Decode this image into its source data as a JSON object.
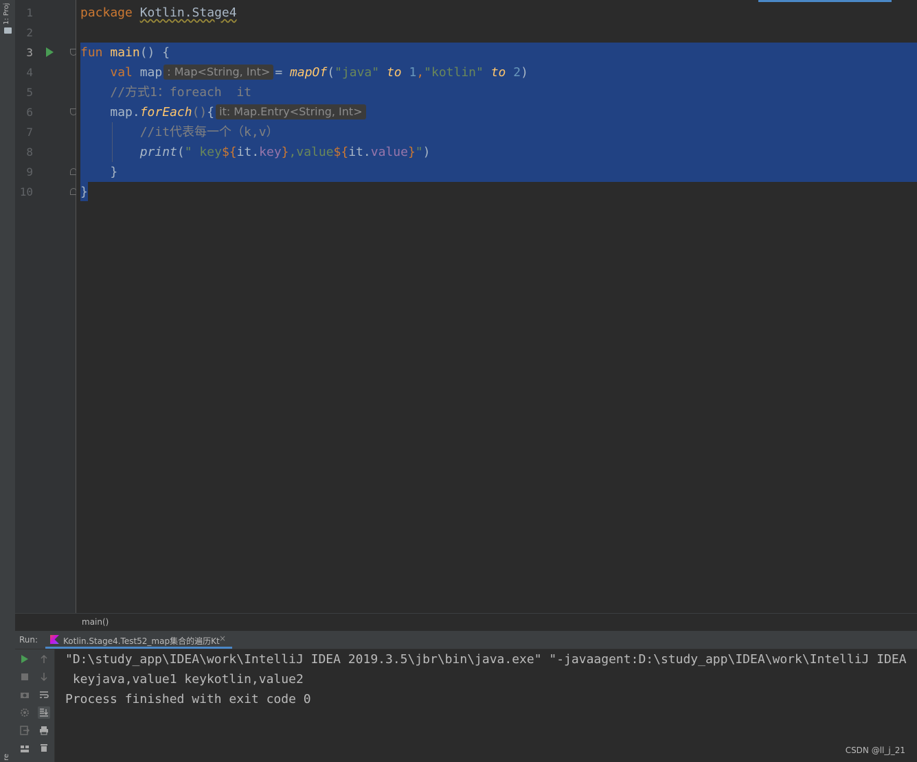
{
  "left_strip": {
    "project_label": "1: Proj",
    "bottom_label": "re"
  },
  "gutter": {
    "line_numbers": [
      "1",
      "2",
      "3",
      "4",
      "5",
      "6",
      "7",
      "8",
      "9",
      "10"
    ]
  },
  "code": {
    "l1_package_kw": "package",
    "l1_package_name": "Kotlin.Stage4",
    "l3_fun_kw": "fun",
    "l3_fun_name": "main",
    "l3_rest": "() {",
    "l4_val_kw": "val",
    "l4_var": "map",
    "l4_type_hint": ": Map<String, Int>",
    "l4_eq": "=",
    "l4_call": "mapOf",
    "l4_paren_open": "(",
    "l4_str1": "\"java\"",
    "l4_to1": "to",
    "l4_num1": "1",
    "l4_comma": ",",
    "l4_str2": "\"kotlin\"",
    "l4_to2": "to",
    "l4_num2": "2",
    "l4_paren_close": ")",
    "l5_comment": "//方式1：foreach  it",
    "l6_recv": "map.",
    "l6_call": "forEach",
    "l6_parens": "()",
    "l6_brace": "{",
    "l6_hint": "it: Map.Entry<String, Int>",
    "l7_comment": "//it代表每一个（k,v）",
    "l8_print": "print",
    "l8_open": "(",
    "l8_q1": "\"",
    "l8_str_a": " key",
    "l8_tmpl1_open": "${",
    "l8_it1": "it",
    "l8_dot1": ".",
    "l8_prop1": "key",
    "l8_tmpl1_close": "}",
    "l8_str_b": ",value",
    "l8_tmpl2_open": "${",
    "l8_it2": "it",
    "l8_dot2": ".",
    "l8_prop2": "value",
    "l8_tmpl2_close": "}",
    "l8_q2": "\"",
    "l8_close": ")",
    "l9_brace": "}",
    "l10_brace": "}"
  },
  "breadcrumb": {
    "label": "main()"
  },
  "run_panel": {
    "run_label": "Run:",
    "tab_title": "Kotlin.Stage4.Test52_map集合的遍历Kt",
    "tab_close": "×",
    "console_lines": [
      "\"D:\\study_app\\IDEA\\work\\IntelliJ IDEA 2019.3.5\\jbr\\bin\\java.exe\" \"-javaagent:D:\\study_app\\IDEA\\work\\IntelliJ IDEA",
      " keyjava,value1 keykotlin,value2",
      "Process finished with exit code 0"
    ]
  },
  "watermark": "CSDN @ll_j_21",
  "colors": {
    "keyword": "#cc7832",
    "function": "#ffc66d",
    "string": "#6a8759",
    "number": "#6897bb",
    "comment": "#808080",
    "property": "#9876aa",
    "selection": "#214283",
    "run_icon": "#499c54"
  }
}
